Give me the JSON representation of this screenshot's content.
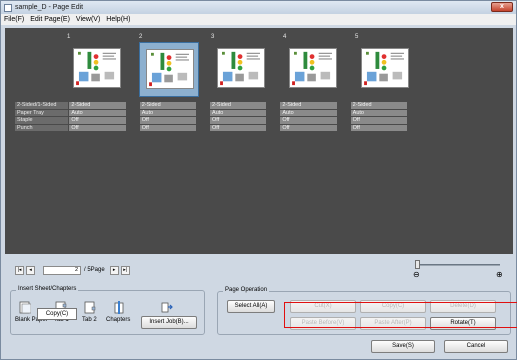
{
  "window": {
    "title": "sample_D - Page Edit",
    "close_label": "x"
  },
  "menu": [
    "File(F)",
    "Edit Page(E)",
    "View(V)",
    "Help(H)"
  ],
  "pages": [
    {
      "number": "1",
      "selected": false
    },
    {
      "number": "2",
      "selected": true
    },
    {
      "number": "3",
      "selected": false
    },
    {
      "number": "4",
      "selected": false
    },
    {
      "number": "5",
      "selected": false
    }
  ],
  "properties": {
    "labels": [
      "2-Sided/1-Sided",
      "Paper Tray",
      "Staple",
      "Punch"
    ],
    "values": [
      [
        "2-Sided",
        "2-Sided",
        "2-Sided",
        "2-Sided",
        "2-Sided"
      ],
      [
        "Auto",
        "Auto",
        "Auto",
        "Auto",
        "Auto"
      ],
      [
        "Off",
        "Off",
        "Off",
        "Off",
        "Off"
      ],
      [
        "Off",
        "Off",
        "Off",
        "Off",
        "Off"
      ]
    ]
  },
  "navigation": {
    "first_icon": "first-page-icon",
    "prev_icon": "prev-page-icon",
    "next_icon": "next-page-icon",
    "last_icon": "last-page-icon",
    "current_page": "2",
    "total_pages": "/ 5Page"
  },
  "zoom": {
    "out_symbol": "⊖",
    "in_symbol": "⊕",
    "level": 0
  },
  "insert_sheet": {
    "title": "Insert Sheet/Chapters",
    "items": [
      "Blank Paper",
      "Tab 1",
      "Tab 2",
      "Chapters"
    ],
    "insert_job": "Insert Job(B)..."
  },
  "tooltip": "Copy(C)",
  "page_operation": {
    "title": "Page Operation",
    "select_all": "Select All(A)",
    "cut": "Cut(X)",
    "copy": "Copy(C)",
    "delete": "Delete(D)",
    "paste_before": "Paste Before(V)",
    "paste_after": "Paste After(P)",
    "rotate": "Rotate(T)"
  },
  "footer": {
    "save": "Save(S)",
    "cancel": "Cancel"
  },
  "colors": {
    "highlight": "#e01010",
    "workspace": "#4a4a4a",
    "selected_frame": "#8db0cf"
  }
}
